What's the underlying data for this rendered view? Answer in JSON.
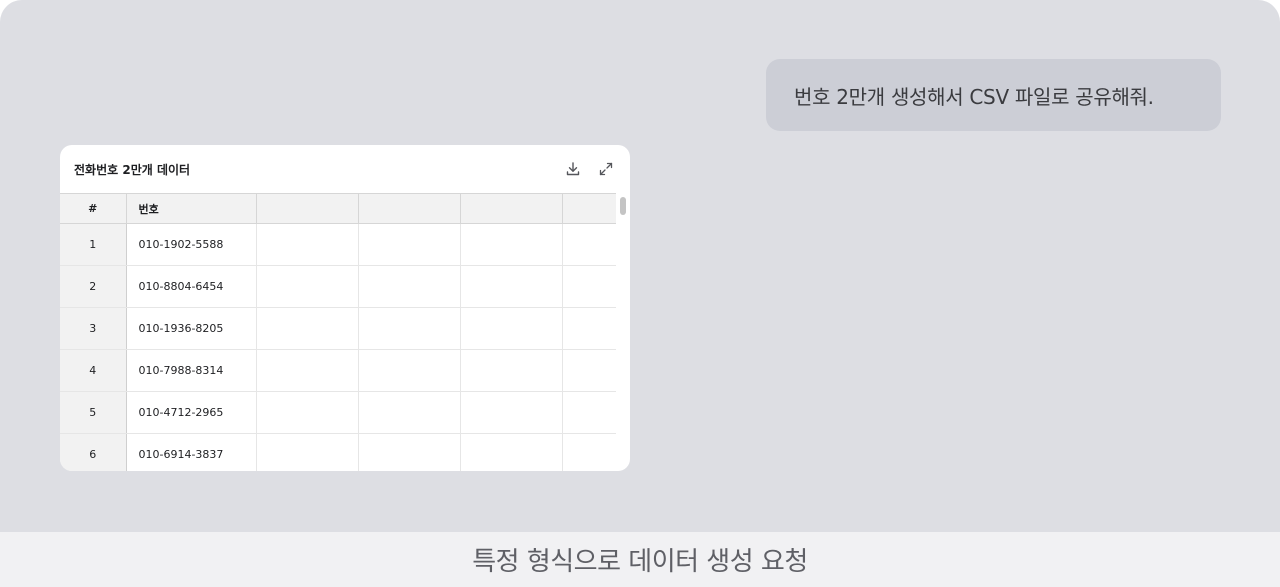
{
  "chat": {
    "user_message": "번호 2만개 생성해서 CSV 파일로 공유해줘."
  },
  "card": {
    "title": "전화번호 2만개 데이터",
    "download_icon": "download-icon",
    "expand_icon": "expand-icon",
    "columns": [
      "#",
      "번호",
      "",
      "",
      "",
      ""
    ],
    "rows": [
      {
        "index": "1",
        "number": "010-1902-5588"
      },
      {
        "index": "2",
        "number": "010-8804-6454"
      },
      {
        "index": "3",
        "number": "010-1936-8205"
      },
      {
        "index": "4",
        "number": "010-7988-8314"
      },
      {
        "index": "5",
        "number": "010-4712-2965"
      },
      {
        "index": "6",
        "number": "010-6914-3837"
      }
    ]
  },
  "caption": "특정 형식으로 데이터 생성 요청"
}
